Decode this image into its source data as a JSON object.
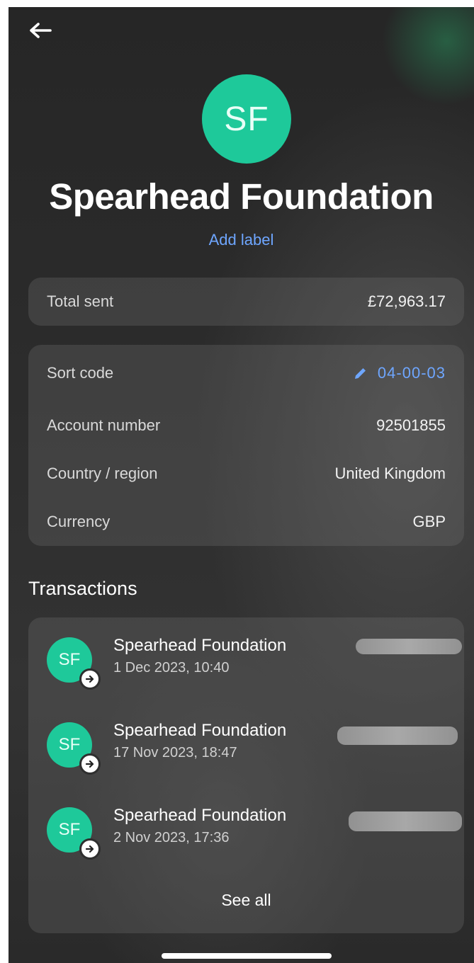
{
  "header": {
    "back_icon": "arrow-left-icon",
    "avatar_initials": "SF",
    "name": "Spearhead Foundation",
    "add_label": "Add label"
  },
  "total": {
    "label": "Total sent",
    "value": "£72,963.17"
  },
  "details": {
    "sort_code_label": "Sort code",
    "sort_code_value": "04-00-03",
    "account_number_label": "Account number",
    "account_number_value": "92501855",
    "country_label": "Country / region",
    "country_value": "United Kingdom",
    "currency_label": "Currency",
    "currency_value": "GBP"
  },
  "transactions": {
    "title": "Transactions",
    "items": [
      {
        "initials": "SF",
        "name": "Spearhead Foundation",
        "date": "1 Dec 2023, 10:40"
      },
      {
        "initials": "SF",
        "name": "Spearhead Foundation",
        "date": "17 Nov 2023, 18:47"
      },
      {
        "initials": "SF",
        "name": "Spearhead Foundation",
        "date": "2 Nov 2023, 17:36"
      }
    ],
    "see_all": "See all"
  },
  "colors": {
    "accent_green": "#1ec99a",
    "link_blue": "#6ea6ff"
  }
}
